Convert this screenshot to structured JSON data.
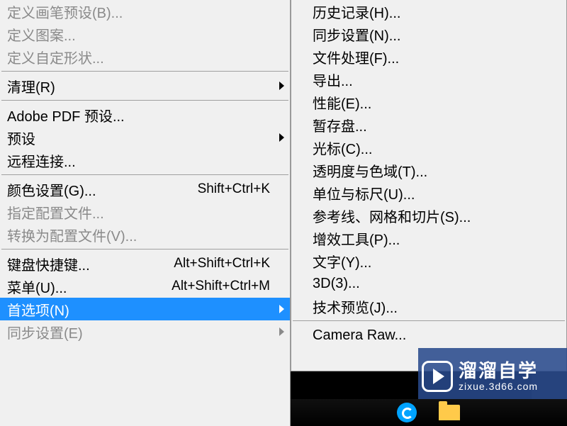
{
  "left": {
    "define_brush": "定义画笔预设(B)...",
    "define_pattern": "定义图案...",
    "define_shape": "定义自定形状...",
    "purge": "清理(R)",
    "adobe_pdf": "Adobe PDF 预设...",
    "presets": "预设",
    "remote": "远程连接...",
    "color_settings": "颜色设置(G)...",
    "color_settings_sc": "Shift+Ctrl+K",
    "assign_profile": "指定配置文件...",
    "convert_profile": "转换为配置文件(V)...",
    "keyboard": "键盘快捷键...",
    "keyboard_sc": "Alt+Shift+Ctrl+K",
    "menus": "菜单(U)...",
    "menus_sc": "Alt+Shift+Ctrl+M",
    "preferences": "首选项(N)",
    "sync_settings": "同步设置(E)"
  },
  "right": {
    "history": "历史记录(H)...",
    "sync": "同步设置(N)...",
    "file_handling": "文件处理(F)...",
    "export": "导出...",
    "performance": "性能(E)...",
    "scratch": "暂存盘...",
    "cursor": "光标(C)...",
    "transparency": "透明度与色域(T)...",
    "units": "单位与标尺(U)...",
    "guides": "参考线、网格和切片(S)...",
    "plugins": "增效工具(P)...",
    "type": "文字(Y)...",
    "threeD": "3D(3)...",
    "tech_preview": "技术预览(J)...",
    "camera_raw": "Camera Raw..."
  },
  "watermark": {
    "title": "溜溜自学",
    "url": "zixue.3d66.com"
  }
}
